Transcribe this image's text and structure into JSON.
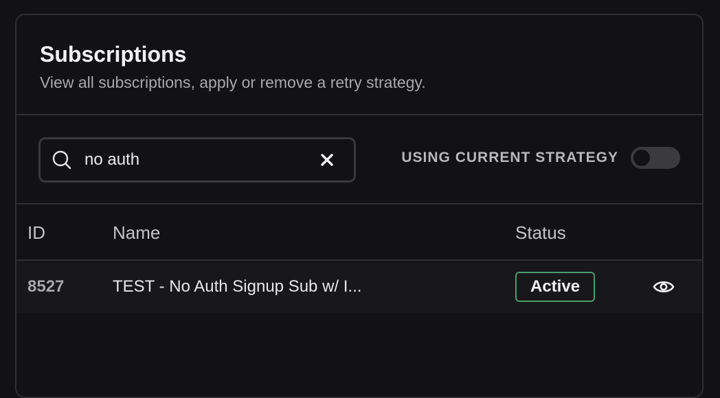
{
  "card": {
    "title": "Subscriptions",
    "subtitle": "View all subscriptions, apply or remove a retry strategy."
  },
  "search": {
    "value": "no auth",
    "icon": "search-icon",
    "clear_icon": "close-icon"
  },
  "filter": {
    "toggle_label": "USING CURRENT STRATEGY",
    "toggle_on": false
  },
  "table": {
    "columns": [
      "ID",
      "Name",
      "Status"
    ],
    "rows": [
      {
        "id": "8527",
        "name": "TEST - No Auth Signup Sub w/ I...",
        "status": "Active",
        "action_icon": "eye-icon"
      }
    ]
  },
  "colors": {
    "background": "#121214",
    "border": "#2f2f33",
    "status_active_border": "#4e9a72"
  }
}
